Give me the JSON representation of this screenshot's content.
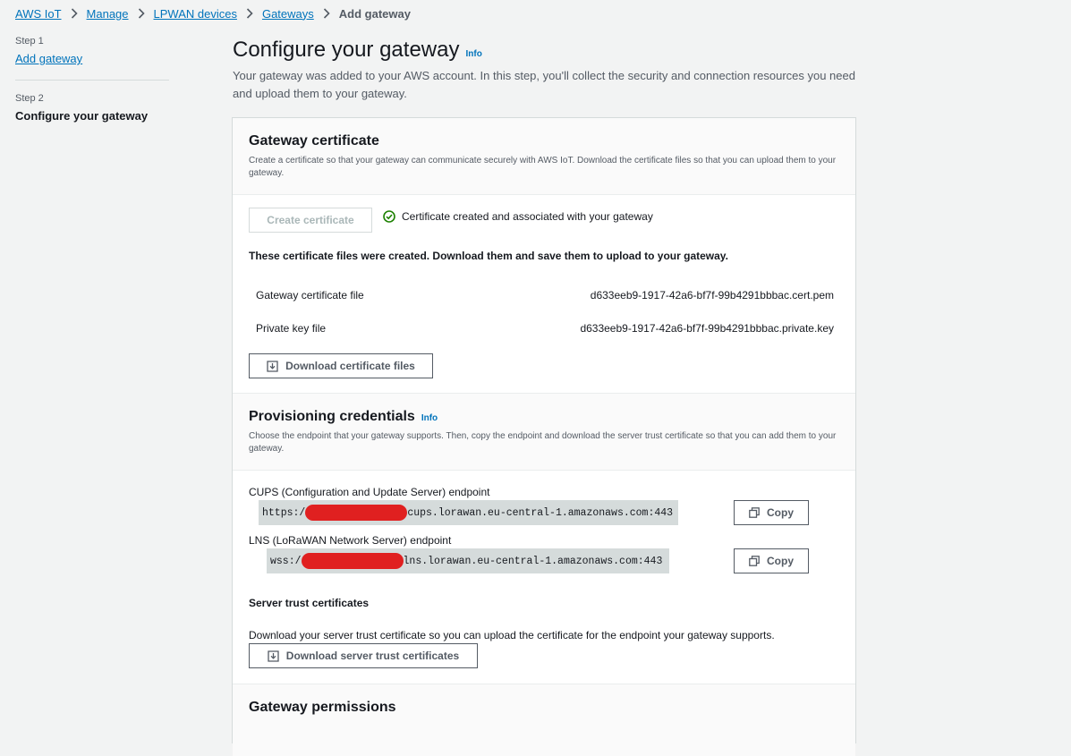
{
  "breadcrumb": {
    "items": [
      "AWS IoT",
      "Manage",
      "LPWAN devices",
      "Gateways"
    ],
    "current": "Add gateway"
  },
  "steps": {
    "step1_label": "Step 1",
    "step1_link": "Add gateway",
    "step2_label": "Step 2",
    "step2_title": "Configure your gateway"
  },
  "page": {
    "title": "Configure your gateway",
    "info": "Info",
    "description": "Your gateway was added to your AWS account. In this step, you'll collect the security and connection resources you need and upload them to your gateway."
  },
  "cert_section": {
    "title": "Gateway certificate",
    "subtitle": "Create a certificate so that your gateway can communicate securely with AWS IoT. Download the certificate files so that you can upload them to your gateway.",
    "create_button": "Create certificate",
    "status": "Certificate created and associated with your gateway",
    "files_intro": "These certificate files were created. Download them and save them to upload to your gateway.",
    "files": [
      {
        "label": "Gateway certificate file",
        "value": "d633eeb9-1917-42a6-bf7f-99b4291bbbac.cert.pem"
      },
      {
        "label": "Private key file",
        "value": "d633eeb9-1917-42a6-bf7f-99b4291bbbac.private.key"
      }
    ],
    "download_button": "Download certificate files"
  },
  "prov_section": {
    "title": "Provisioning credentials",
    "info": "Info",
    "subtitle": "Choose the endpoint that your gateway supports. Then, copy the endpoint and download the server trust certificate so that you can add them to your gateway.",
    "cups_label": "CUPS (Configuration and Update Server) endpoint",
    "cups_prefix": "https:/",
    "cups_suffix": "cups.lorawan.eu-central-1.amazonaws.com:443",
    "lns_label": "LNS (LoRaWAN Network Server) endpoint",
    "lns_prefix": "wss:/",
    "lns_suffix": "lns.lorawan.eu-central-1.amazonaws.com:443",
    "copy_button": "Copy",
    "trust_title": "Server trust certificates",
    "trust_desc": "Download your server trust certificate so you can upload the certificate for the endpoint your gateway supports.",
    "trust_button": "Download server trust certificates"
  },
  "perm_section": {
    "title": "Gateway permissions"
  },
  "colors": {
    "link": "#0073bb",
    "success": "#1d8102",
    "redaction": "#e02020"
  }
}
